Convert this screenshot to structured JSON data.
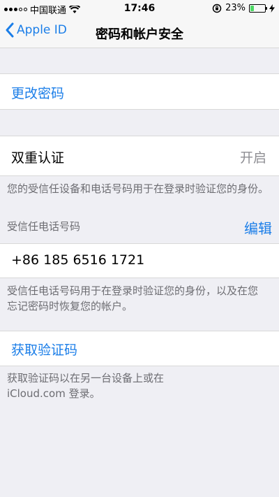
{
  "status_bar": {
    "carrier": "中国联通",
    "time": "17:46",
    "battery": "23%",
    "battery_level": 0.23
  },
  "nav": {
    "back_label": "Apple ID",
    "title": "密码和帐户安全"
  },
  "change_password": {
    "label": "更改密码"
  },
  "two_factor": {
    "label": "双重认证",
    "status": "开启",
    "description": "您的受信任设备和电话号码用于在登录时验证您的身份。"
  },
  "trusted_phone": {
    "header": "受信任电话号码",
    "edit_label": "编辑",
    "number": "+86 185 6516 1721",
    "description": "受信任电话号码用于在登录时验证您的身份，以及在您忘记密码时恢复您的帐户。"
  },
  "verification": {
    "label": "获取验证码",
    "description": "获取验证码以在另一台设备上或在 iCloud.com 登录。"
  },
  "colors": {
    "accent": "#1b7ee8",
    "background": "#efeff4",
    "battery_fill": "#4cd964"
  }
}
